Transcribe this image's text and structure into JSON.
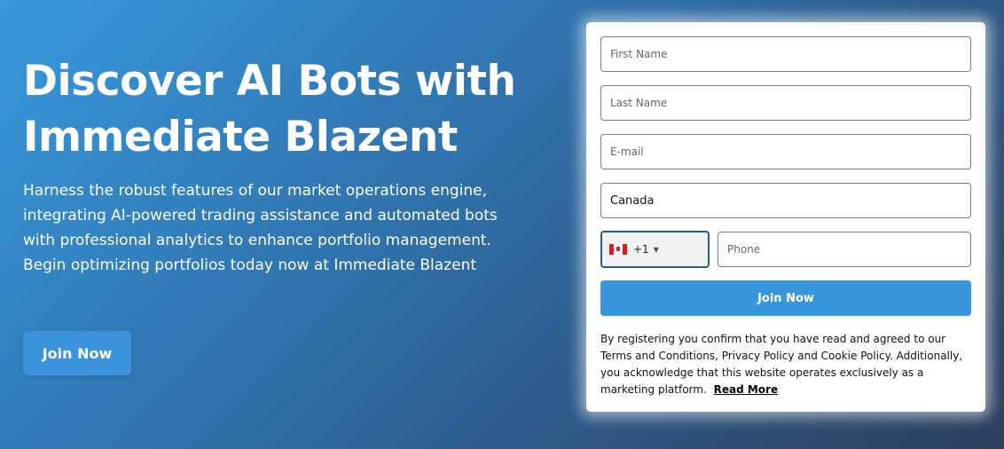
{
  "hero": {
    "title": "Discover AI Bots with Immediate Blazent",
    "description": "Harness the robust features of our market operations engine, integrating AI-powered trading assistance and automated bots with professional analytics to enhance portfolio management. Begin optimizing portfolios today now at Immediate Blazent",
    "button_label": "Join Now"
  },
  "form": {
    "first_name_placeholder": "First Name",
    "last_name_placeholder": "Last Name",
    "email_placeholder": "E-mail",
    "country_value": "Canada",
    "dial_code": "+1",
    "flag_icon": "canada-flag-icon",
    "phone_placeholder": "Phone",
    "submit_label": "Join Now",
    "disclaimer": "By registering you confirm that you have read and agreed to our Terms and Conditions, Privacy Policy and Cookie Policy. Additionally, you acknowledge that this website operates exclusively as a marketing platform.",
    "read_more_label": "Read More"
  },
  "colors": {
    "accent": "#3796dc",
    "background_start": "#3799de",
    "background_end": "#2c3f5c"
  }
}
